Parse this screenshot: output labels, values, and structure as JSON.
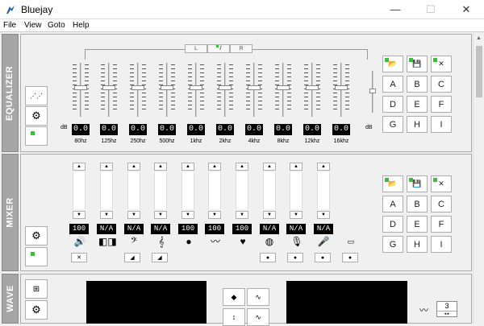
{
  "window": {
    "title": "Bluejay",
    "minimize": "—",
    "maximize": "☐",
    "close": "✕"
  },
  "menu": [
    "File",
    "View",
    "Goto",
    "Help"
  ],
  "equalizer": {
    "label": "EQUALIZER",
    "channels": {
      "left": "L",
      "link": "/",
      "right": "R"
    },
    "db": "dB",
    "bands": [
      {
        "freq": "80hz",
        "value": "0.0",
        "level": 0.5
      },
      {
        "freq": "125hz",
        "value": "0.0",
        "level": 0.5
      },
      {
        "freq": "250hz",
        "value": "0.0",
        "level": 0.5
      },
      {
        "freq": "500hz",
        "value": "0.0",
        "level": 0.5
      },
      {
        "freq": "1khz",
        "value": "0.0",
        "level": 0.5
      },
      {
        "freq": "2khz",
        "value": "0.0",
        "level": 0.5
      },
      {
        "freq": "4khz",
        "value": "0.0",
        "level": 0.5
      },
      {
        "freq": "8khz",
        "value": "0.0",
        "level": 0.5
      },
      {
        "freq": "12khz",
        "value": "0.0",
        "level": 0.5
      },
      {
        "freq": "16khz",
        "value": "0.0",
        "level": 0.5
      }
    ],
    "presets": [
      "A",
      "B",
      "C",
      "D",
      "E",
      "F",
      "G",
      "H",
      "I"
    ]
  },
  "mixer": {
    "label": "MIXER",
    "channels": [
      {
        "vol": "100",
        "gain": "N/A"
      },
      {
        "vol": "",
        "gain": "N/A"
      },
      {
        "vol": "",
        "gain": "N/A"
      },
      {
        "vol": "",
        "gain": "N/A"
      },
      {
        "vol": "100",
        "gain": ""
      },
      {
        "vol": "100",
        "gain": ""
      },
      {
        "vol": "100",
        "gain": ""
      },
      {
        "vol": "",
        "gain": "N/A"
      },
      {
        "vol": "",
        "gain": "N/A"
      },
      {
        "vol": "",
        "gain": "N/A"
      }
    ],
    "values": [
      "100",
      "N/A",
      "N/A",
      "N/A",
      "100",
      "100",
      "100",
      "N/A",
      "N/A",
      "N/A"
    ],
    "presets": [
      "A",
      "B",
      "C",
      "D",
      "E",
      "F",
      "G",
      "H",
      "I"
    ]
  },
  "wave": {
    "label": "WAVE",
    "count": "3"
  }
}
